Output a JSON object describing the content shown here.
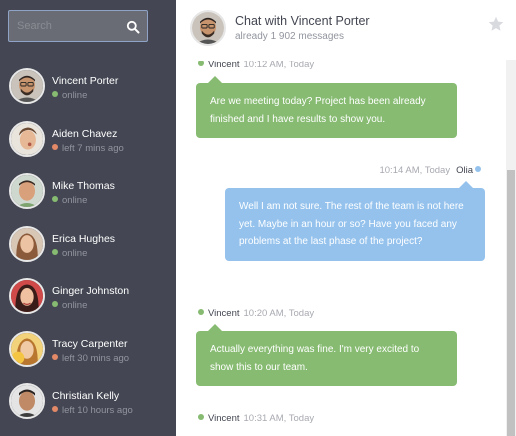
{
  "search": {
    "placeholder": "Search"
  },
  "people": [
    {
      "name": "Vincent Porter",
      "status": "online",
      "state": "online"
    },
    {
      "name": "Aiden Chavez",
      "status": "left 7 mins ago",
      "state": "away"
    },
    {
      "name": "Mike Thomas",
      "status": "online",
      "state": "online"
    },
    {
      "name": "Erica Hughes",
      "status": "online",
      "state": "online"
    },
    {
      "name": "Ginger Johnston",
      "status": "online",
      "state": "online"
    },
    {
      "name": "Tracy Carpenter",
      "status": "left 30 mins ago",
      "state": "away"
    },
    {
      "name": "Christian Kelly",
      "status": "left 10 hours ago",
      "state": "away"
    }
  ],
  "chat": {
    "title": "Chat with Vincent Porter",
    "count": "already 1 902 messages"
  },
  "messages": [
    {
      "author": "Vincent",
      "time": "10:12 AM, Today",
      "text": "Are we meeting today? Project has been already finished and I have results to show you."
    },
    {
      "author": "Olia",
      "time": "10:14 AM, Today",
      "text": "Well I am not sure. The rest of the team is not here yet. Maybe in an hour or so? Have you faced any problems at the last phase of the project?"
    },
    {
      "author": "Vincent",
      "time": "10:20 AM, Today",
      "text": "Actually everything was fine. I'm very excited to show this to our team."
    },
    {
      "author": "Vincent",
      "time": "10:31 AM, Today",
      "text": ""
    }
  ],
  "colors": {
    "sidebar": "#444753",
    "online": "#86bb71",
    "away": "#e38968",
    "other_bubble": "#86bb71",
    "my_bubble": "#94c2ed"
  },
  "icons": {
    "search": "search-icon",
    "star": "star-icon"
  }
}
